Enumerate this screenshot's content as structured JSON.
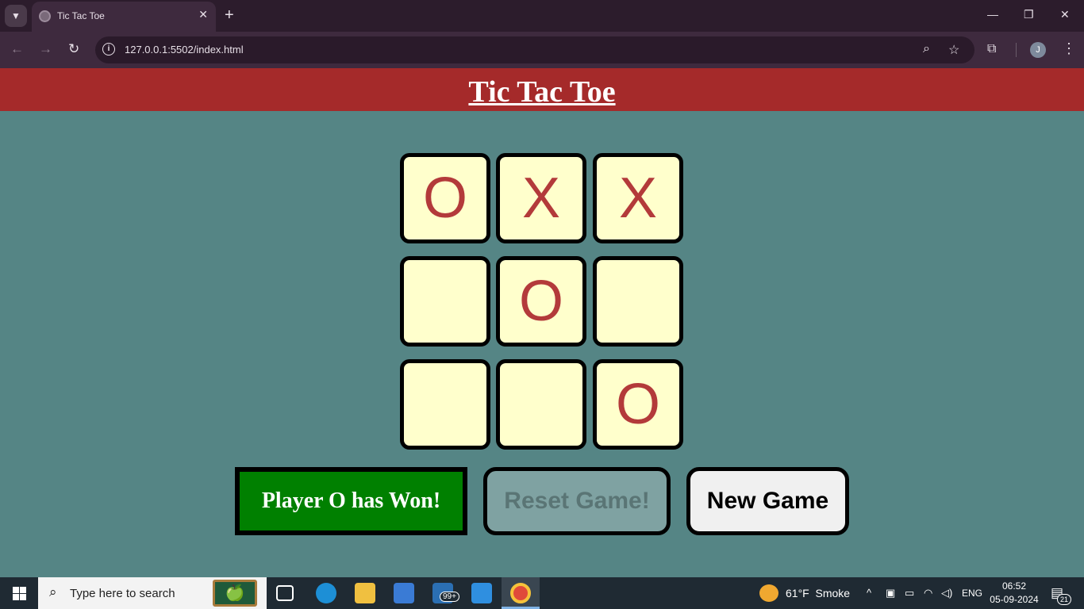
{
  "browser": {
    "tab_title": "Tic Tac Toe",
    "url": "127.0.0.1:5502/index.html",
    "avatar_letter": "J"
  },
  "page": {
    "title": "Tic Tac Toe",
    "board": [
      "O",
      "X",
      "X",
      "",
      "O",
      "",
      "",
      "",
      "O"
    ],
    "message": "Player O has Won!",
    "reset_label": "Reset Game!",
    "new_game_label": "New Game"
  },
  "taskbar": {
    "search_placeholder": "Type here to search",
    "mail_badge": "99+",
    "weather_temp": "61°F",
    "weather_condition": "Smoke",
    "language": "ENG",
    "time": "06:52",
    "date": "05-09-2024",
    "notification_count": "21"
  },
  "colors": {
    "header": "#a52a2a",
    "background": "#558585",
    "cell": "#ffffcc",
    "mark": "#b33a3a",
    "win": "#008000"
  }
}
